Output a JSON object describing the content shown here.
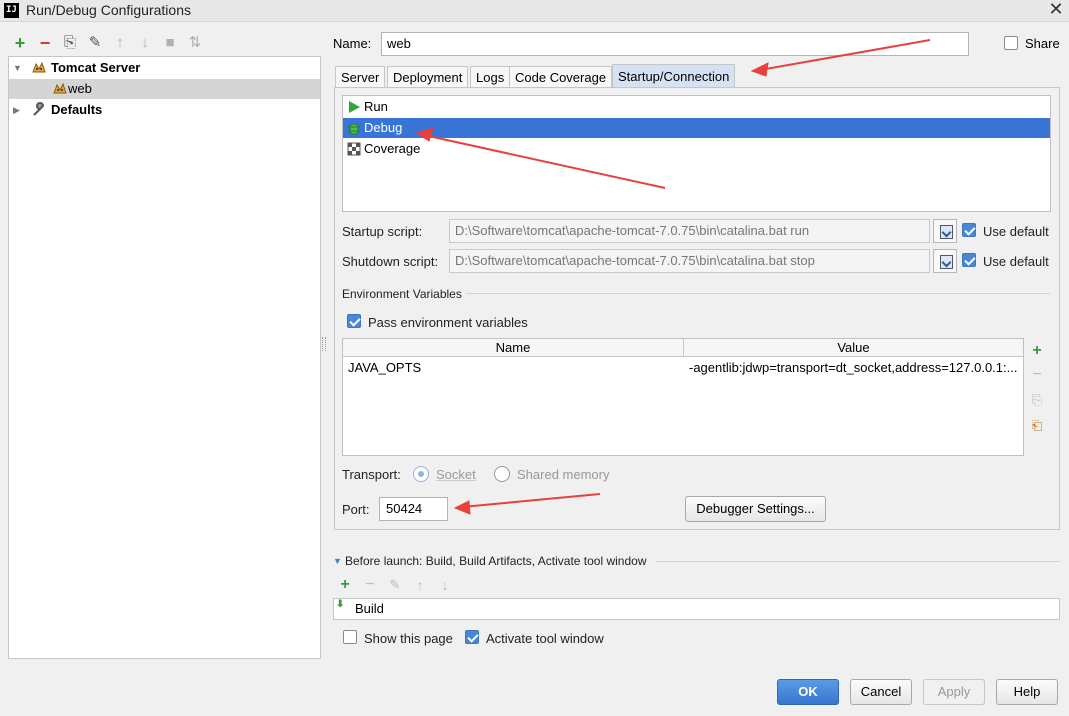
{
  "window": {
    "title": "Run/Debug Configurations",
    "app_icon": "IJ",
    "close": "✕"
  },
  "toolbar": [
    {
      "name": "add-button",
      "glyph": "+",
      "color": "#3a9a3a",
      "enabled": true
    },
    {
      "name": "remove-button",
      "glyph": "−",
      "color": "#d9332b",
      "enabled": true
    },
    {
      "name": "copy-button",
      "glyph": "⎘",
      "color": "#555555",
      "enabled": true
    },
    {
      "name": "edit-defaults-button",
      "glyph": "✎",
      "color": "#555555",
      "enabled": true
    },
    {
      "name": "move-up-button",
      "glyph": "↑",
      "color": "#b0b0b0",
      "enabled": false
    },
    {
      "name": "move-down-button",
      "glyph": "↓",
      "color": "#b0b0b0",
      "enabled": false
    },
    {
      "name": "folder-button",
      "glyph": "■",
      "color": "#b0b0b0",
      "enabled": false
    },
    {
      "name": "sort-button",
      "glyph": "⇅",
      "color": "#b0b0b0",
      "enabled": false
    }
  ],
  "tree": {
    "tomcat_server": "Tomcat Server",
    "web": "web",
    "defaults": "Defaults"
  },
  "name_field": {
    "label": "Name:",
    "value": "web"
  },
  "share": {
    "label": "Share",
    "checked": false
  },
  "tabs": [
    {
      "label": "Server",
      "active": false
    },
    {
      "label": "Deployment",
      "active": false
    },
    {
      "label": "Logs",
      "active": false
    },
    {
      "label": "Code Coverage",
      "active": false
    },
    {
      "label": "Startup/Connection",
      "active": true
    }
  ],
  "modes": [
    {
      "label": "Run",
      "icon": "run-icon",
      "selected": false
    },
    {
      "label": "Debug",
      "icon": "debug-icon",
      "selected": true
    },
    {
      "label": "Coverage",
      "icon": "coverage-icon",
      "selected": false
    }
  ],
  "startup": {
    "label": "Startup script:",
    "value": "D:\\Software\\tomcat\\apache-tomcat-7.0.75\\bin\\catalina.bat run",
    "use_default_label": "Use default",
    "use_default": true
  },
  "shutdown": {
    "label": "Shutdown script:",
    "value": "D:\\Software\\tomcat\\apache-tomcat-7.0.75\\bin\\catalina.bat stop",
    "use_default_label": "Use default",
    "use_default": true
  },
  "env": {
    "section_label": "Environment Variables",
    "pass_label": "Pass environment variables",
    "pass_checked": true,
    "columns": [
      "Name",
      "Value"
    ],
    "rows": [
      {
        "name": "JAVA_OPTS",
        "value": "-agentlib:jdwp=transport=dt_socket,address=127.0.0.1:..."
      }
    ]
  },
  "transport": {
    "label": "Transport:",
    "options": [
      {
        "label": "Socket",
        "selected": true
      },
      {
        "label": "Shared memory",
        "selected": false
      }
    ]
  },
  "port": {
    "label": "Port:",
    "value": "50424"
  },
  "debugger_settings": "Debugger Settings...",
  "before_launch": {
    "label": "Before launch: Build, Build Artifacts, Activate tool window",
    "items": [
      "Build"
    ]
  },
  "show_page": {
    "label": "Show this page",
    "checked": false
  },
  "activate_tool": {
    "label": "Activate tool window",
    "checked": true
  },
  "buttons": {
    "ok": "OK",
    "cancel": "Cancel",
    "apply": "Apply",
    "help": "Help"
  },
  "colors": {
    "selection": "#3875d7",
    "active_tab": "#d4e2f4",
    "annotation_arrow": "#e8403a",
    "primary_button": "#3877cf"
  }
}
